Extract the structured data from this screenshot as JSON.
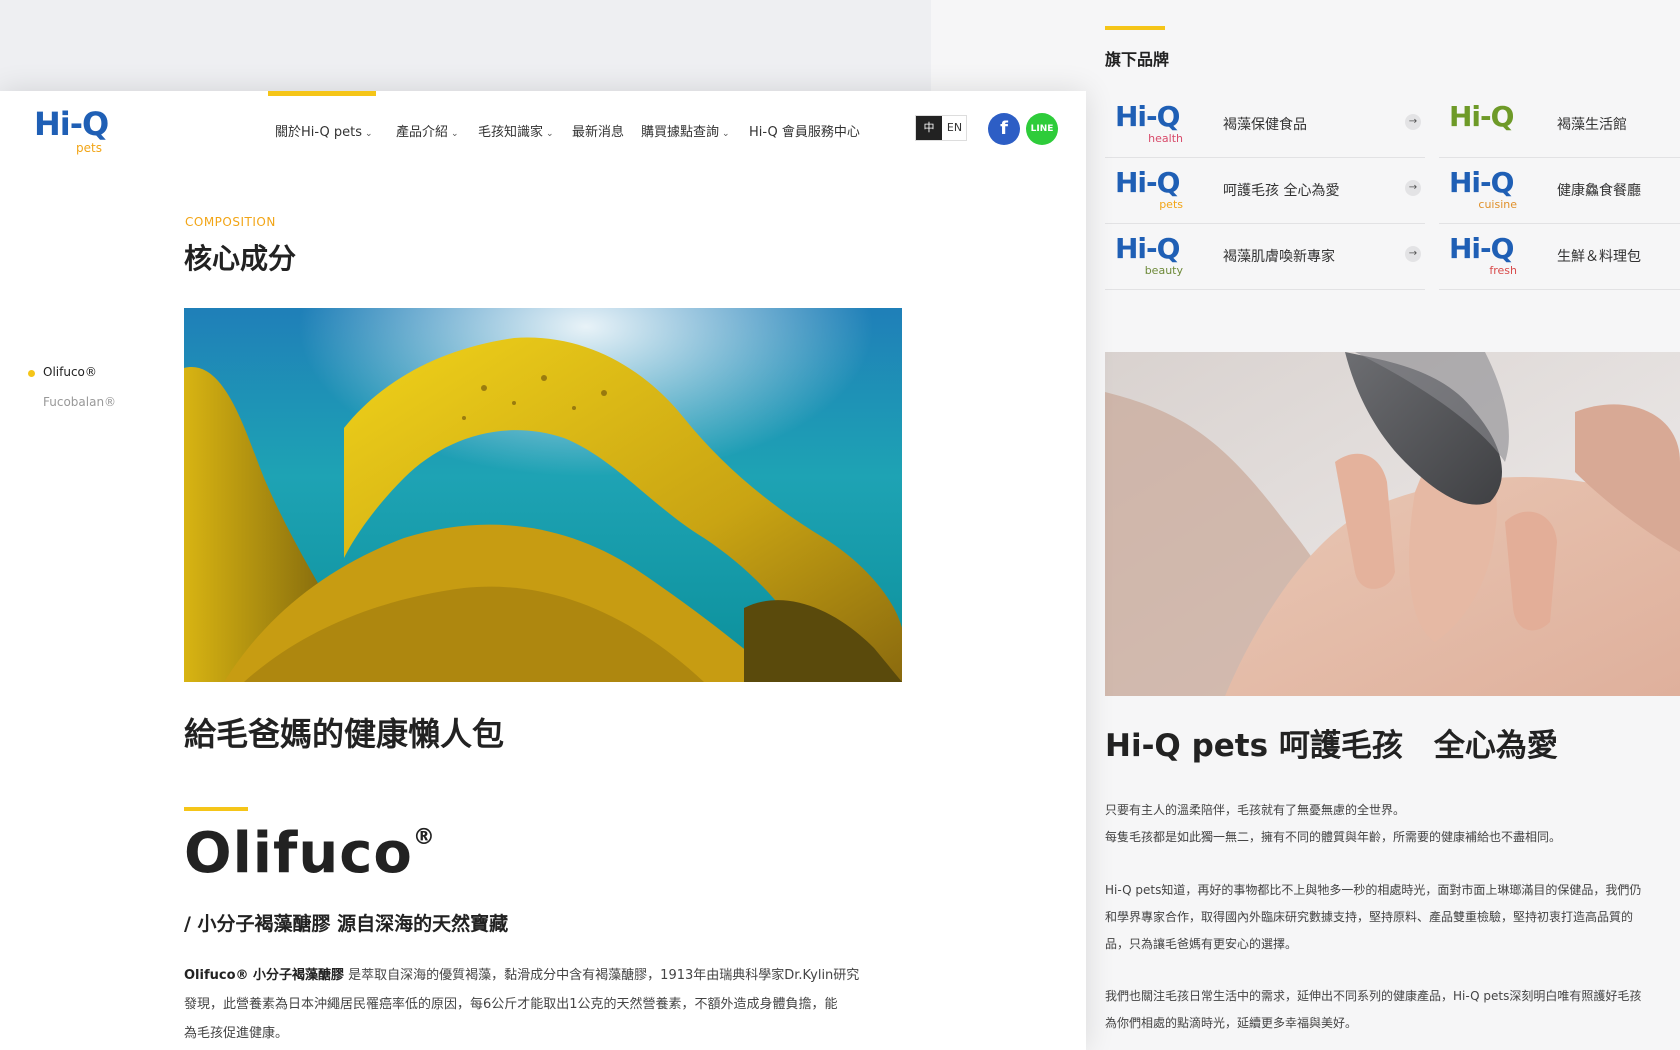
{
  "brands": {
    "title": "旗下品牌",
    "accent": "#f5c518",
    "items": [
      {
        "logo": "Hi-Q",
        "sub": "health",
        "name": "褐藻保健食品",
        "logo_color": "#1f5fb5",
        "sub_color": "#d84a6a"
      },
      {
        "logo": "Hi-Q",
        "sub": "",
        "name": "褐藻生活館",
        "logo_color": "#6e9a28",
        "sub_color": "#6e9a28"
      },
      {
        "logo": "Hi-Q",
        "sub": "pets",
        "name": "呵護毛孩 全心為愛",
        "logo_color": "#1f5fb5",
        "sub_color": "#f2a516"
      },
      {
        "logo": "Hi-Q",
        "sub": "cuisine",
        "name": "健康鱻食餐廳",
        "logo_color": "#1f5fb5",
        "sub_color": "#e0902a"
      },
      {
        "logo": "Hi-Q",
        "sub": "beauty",
        "name": "褐藻肌膚喚新專家",
        "logo_color": "#1f5fb5",
        "sub_color": "#6e8a3a"
      },
      {
        "logo": "Hi-Q",
        "sub": "fresh",
        "name": "生鮮＆料理包",
        "logo_color": "#1f5fb5",
        "sub_color": "#d84a4a"
      }
    ]
  },
  "right_page": {
    "heading": "Hi-Q pets 呵護毛孩　全心為愛",
    "paragraphs": [
      [
        "只要有主人的溫柔陪伴，毛孩就有了無憂無慮的全世界。",
        "每隻毛孩都是如此獨一無二，擁有不同的體質與年齡，所需要的健康補給也不盡相同。"
      ],
      [
        "Hi-Q pets知道，再好的事物都比不上與牠多一秒的相處時光，面對市面上琳瑯滿目的保健品，我們仍",
        "和學界專家合作，取得國內外臨床研究數據支持，堅持原料、產品雙重檢驗，堅持初衷打造高品質的",
        "品，只為讓毛爸媽有更安心的選擇。"
      ],
      [
        "我們也關注毛孩日常生活中的需求，延伸出不同系列的健康產品，Hi-Q pets深刻明白唯有照護好毛孩",
        "為你們相處的點滴時光，延續更多幸福與美好。"
      ]
    ]
  },
  "header": {
    "logo": "Hi-Q",
    "logo_sub": "pets",
    "nav": [
      {
        "label": "關於Hi-Q pets",
        "has_dropdown": true
      },
      {
        "label": "產品介紹",
        "has_dropdown": true
      },
      {
        "label": "毛孩知識家",
        "has_dropdown": true
      },
      {
        "label": "最新消息",
        "has_dropdown": false
      },
      {
        "label": "購買據點查詢",
        "has_dropdown": true
      },
      {
        "label": "Hi-Q 會員服務中心",
        "has_dropdown": false
      }
    ],
    "chevron": "⌄",
    "lang": {
      "zh": "中",
      "en": "EN"
    },
    "social": {
      "facebook": "f",
      "line": "LINE"
    }
  },
  "sidenav": {
    "items": [
      {
        "label": "Olifuco®",
        "active": true
      },
      {
        "label": "Fucobalan®",
        "active": false
      }
    ]
  },
  "content": {
    "eyebrow": "COMPOSITION",
    "title": "核心成分",
    "lazy_title": "給毛爸媽的健康懶人包",
    "product_name": "Olifuco",
    "product_mark": "®",
    "subheading": "/ 小分子褐藻醣膠 源自深海的天然寶藏",
    "body_strong": "Olifuco® 小分子褐藻醣膠",
    "body_lines": [
      " 是萃取自深海的優質褐藻，黏滑成分中含有褐藻醣膠，1913年由瑞典科學家Dr.Kylin研究",
      "發現，此營養素為日本沖繩居民罹癌率低的原因，每6公斤才能取出1公克的天然營養素，不額外造成身體負擔，能",
      "為毛孩促進健康。"
    ]
  },
  "colors": {
    "accent_yellow": "#f5c518",
    "brand_blue": "#1f5fb5",
    "brand_orange": "#f2a516",
    "facebook": "#2d5ec5",
    "line": "#2ecc3a"
  },
  "icons": {
    "arrow": "→"
  }
}
